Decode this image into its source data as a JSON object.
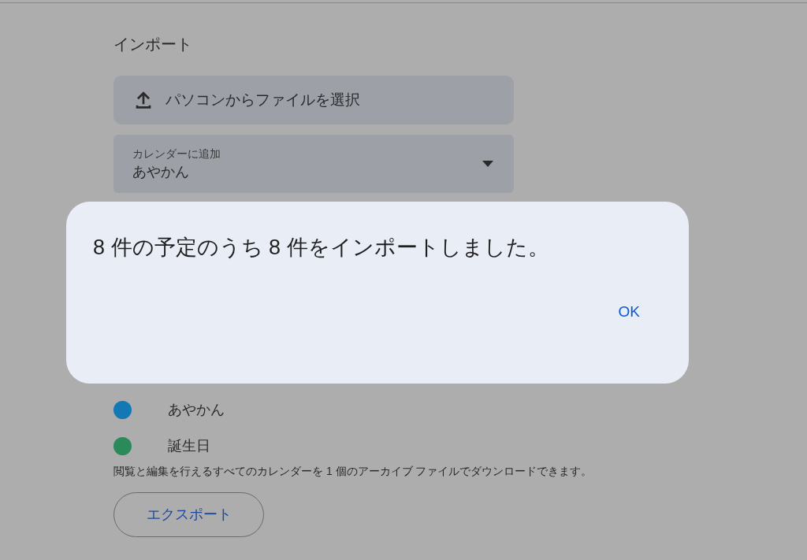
{
  "import": {
    "title": "インポート",
    "upload_button": "パソコンからファイルを選択",
    "calendar_select": {
      "label": "カレンダーに追加",
      "value": "あやかん"
    }
  },
  "calendars": [
    {
      "name": "あやかん",
      "color": "#1478b4"
    },
    {
      "name": "誕生日",
      "color": "#2a8a5a"
    }
  ],
  "export": {
    "description": "閲覧と編集を行えるすべてのカレンダーを 1 個のアーカイブ ファイルでダウンロードできます。",
    "button": "エクスポート"
  },
  "dialog": {
    "message": "8 件の予定のうち 8 件をインポートしました。",
    "ok": "OK"
  }
}
